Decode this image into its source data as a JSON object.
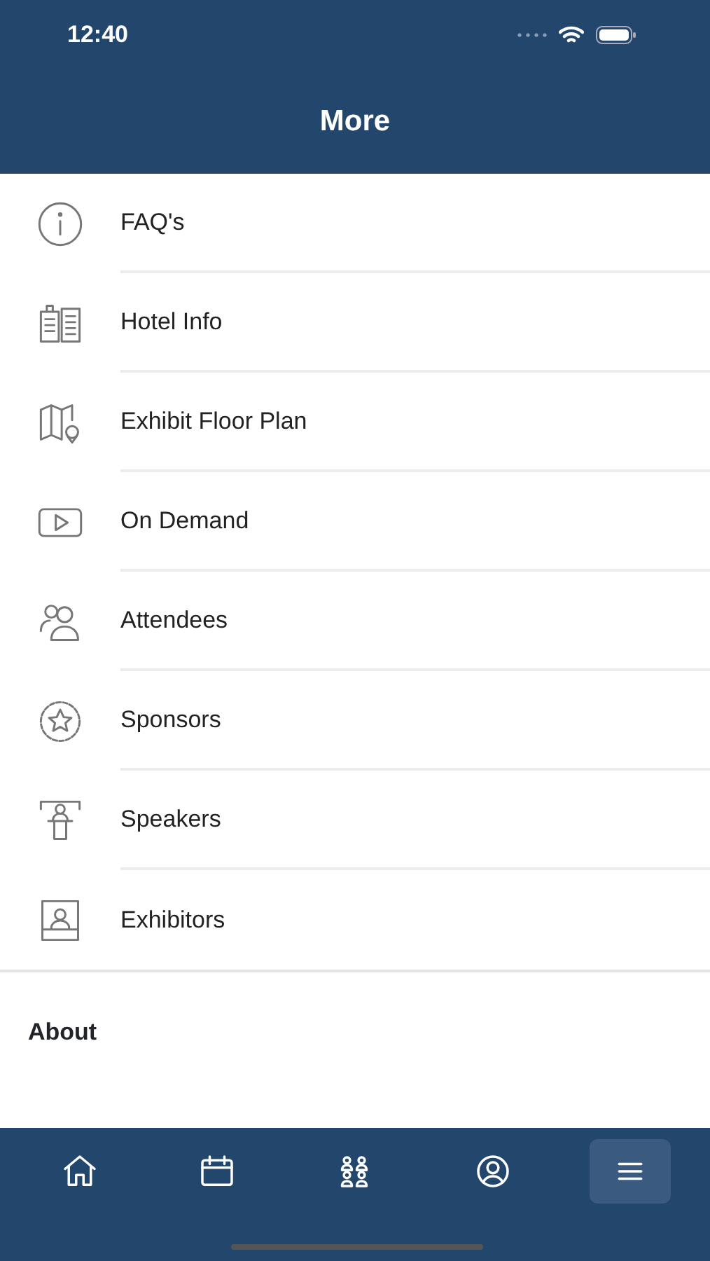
{
  "status_bar": {
    "time": "12:40"
  },
  "header": {
    "title": "More"
  },
  "menu_items": [
    {
      "label": "FAQ's",
      "kind": "info"
    },
    {
      "label": "Hotel Info",
      "kind": "hotel"
    },
    {
      "label": "Exhibit Floor Plan",
      "kind": "map"
    },
    {
      "label": "On Demand",
      "kind": "video"
    },
    {
      "label": "Attendees",
      "kind": "people"
    },
    {
      "label": "Sponsors",
      "kind": "badge"
    },
    {
      "label": "Speakers",
      "kind": "speaker"
    },
    {
      "label": "Exhibitors",
      "kind": "exhibitor"
    }
  ],
  "sections": [
    {
      "label": "About"
    }
  ],
  "tab_bar": [
    {
      "kind": "home",
      "selected": false
    },
    {
      "kind": "calendar",
      "selected": false
    },
    {
      "kind": "group",
      "selected": false
    },
    {
      "kind": "profile",
      "selected": false
    },
    {
      "kind": "menu",
      "selected": true
    }
  ]
}
